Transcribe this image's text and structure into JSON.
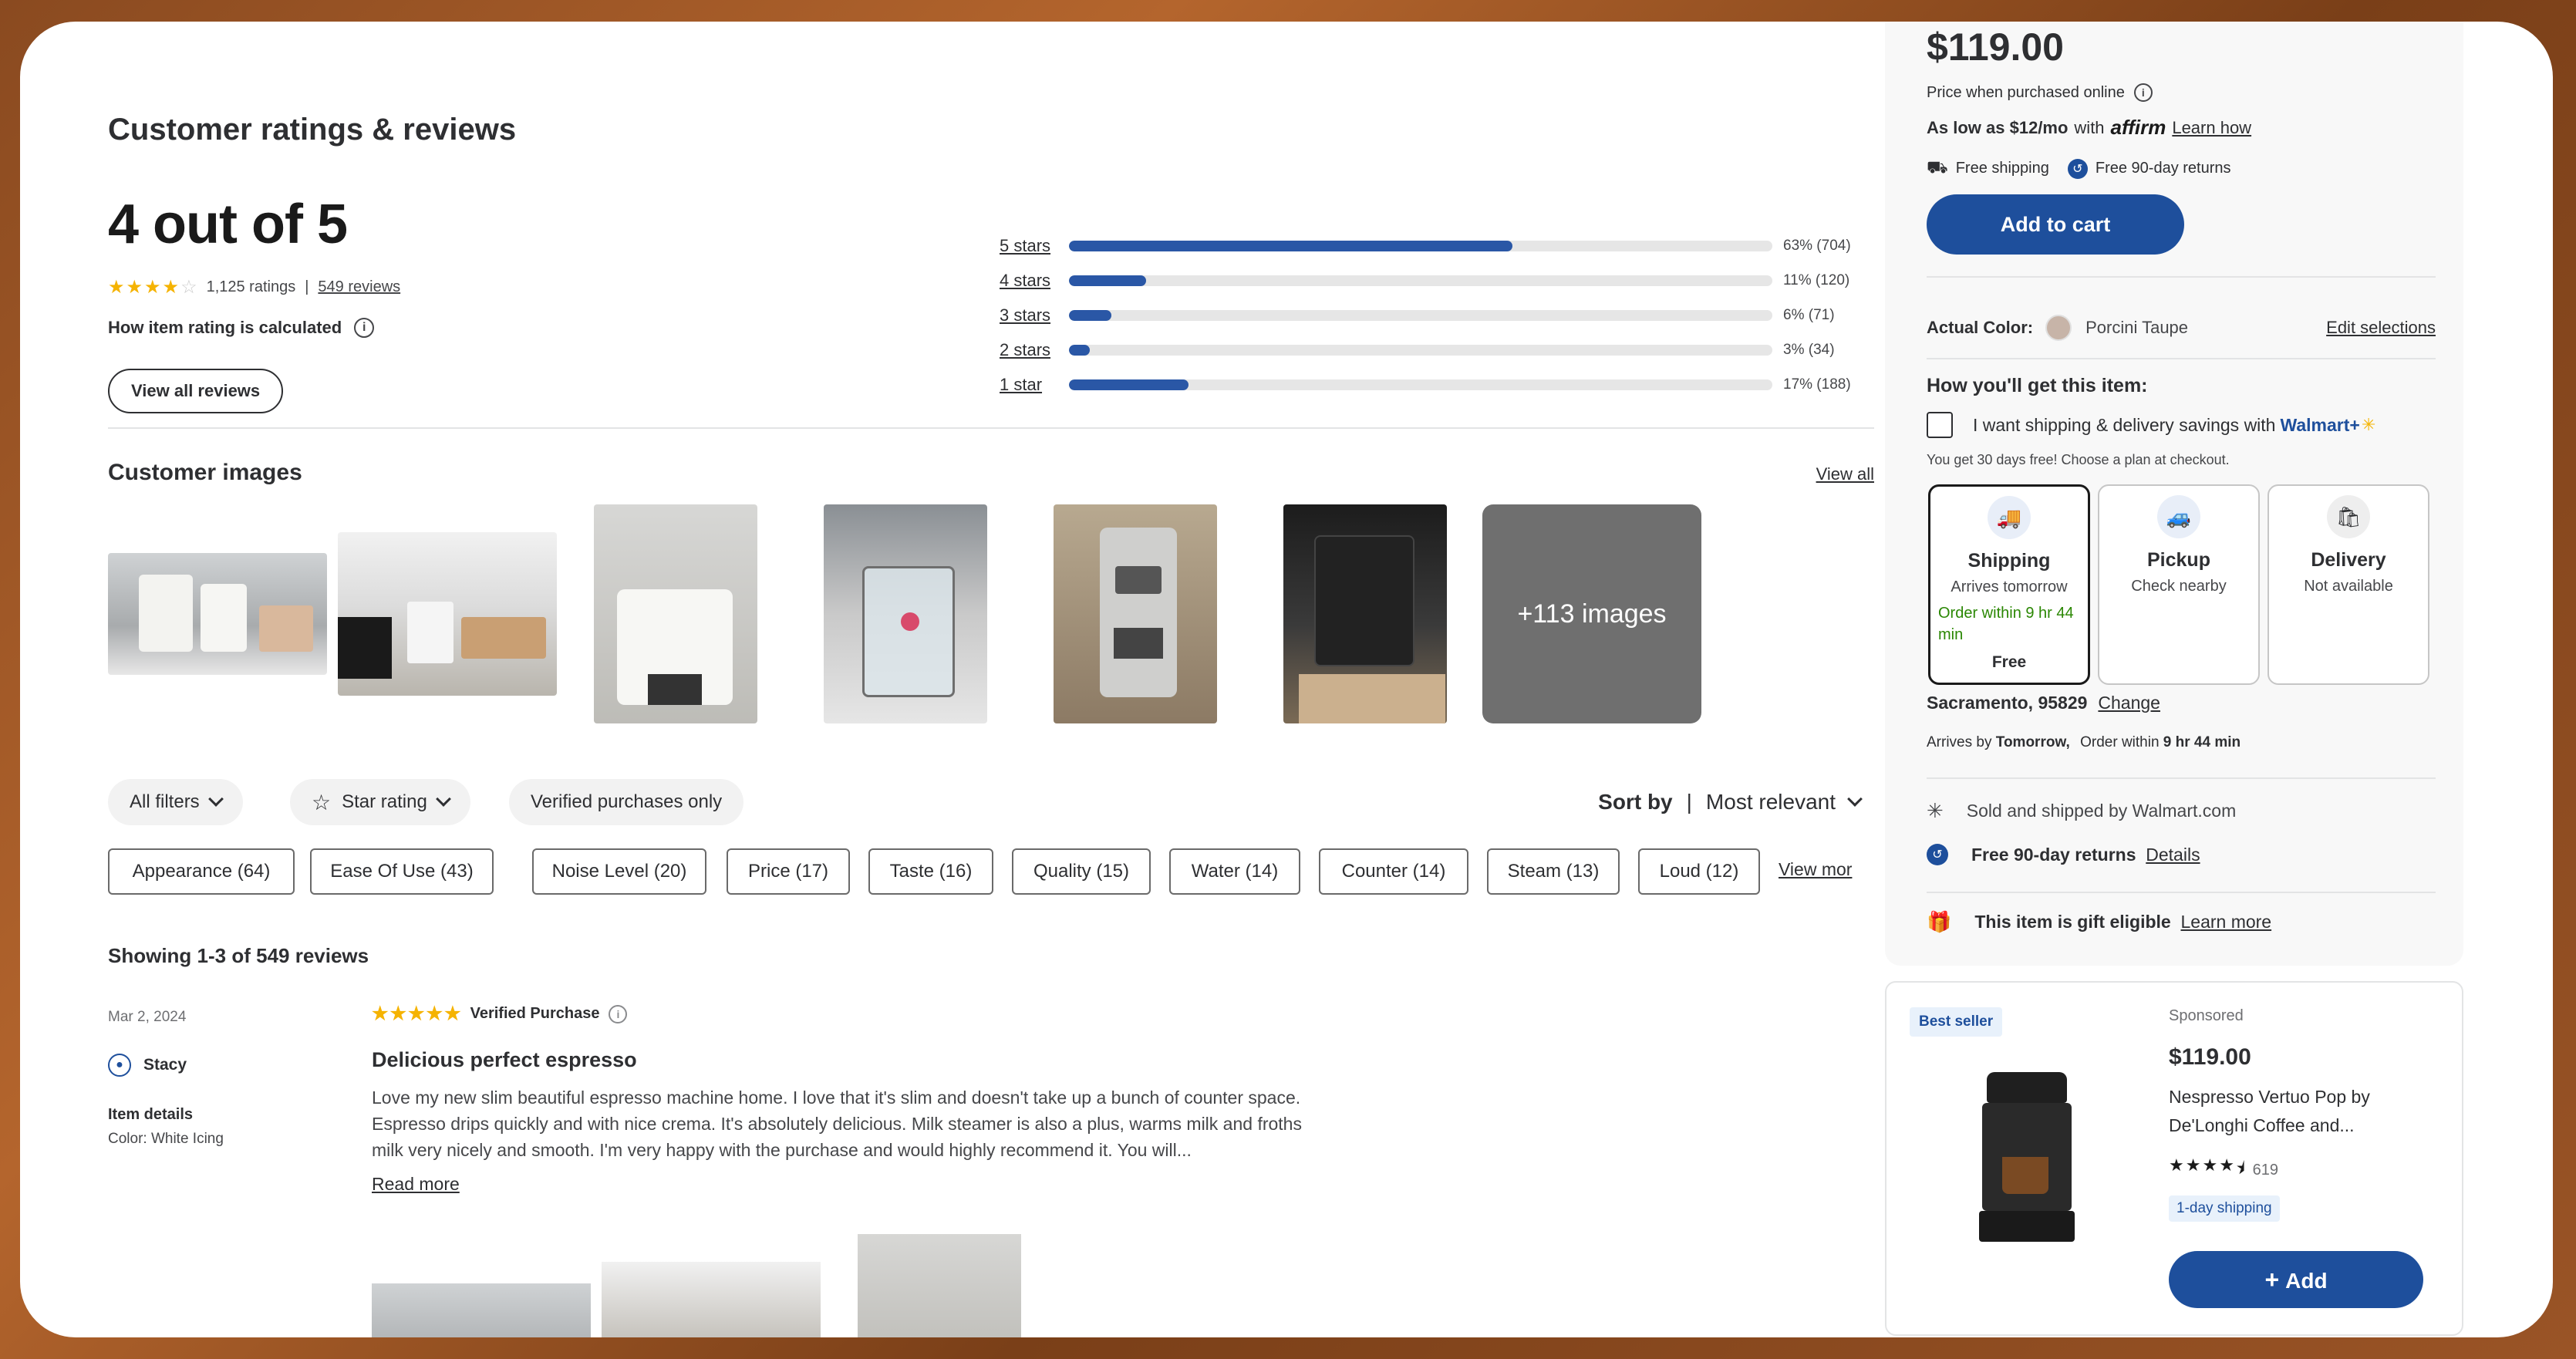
{
  "ratings": {
    "heading": "Customer ratings & reviews",
    "summary": "4 out of 5",
    "stars_value": 4,
    "ratings_count": "1,125 ratings",
    "separator": "|",
    "reviews_link": "549 reviews",
    "how_calc": "How item rating is calculated",
    "view_all_reviews": "View all reviews",
    "histogram": [
      {
        "label": "5 stars",
        "fraction": 0.63,
        "pct": "63% (704)"
      },
      {
        "label": "4 stars",
        "fraction": 0.11,
        "pct": "11% (120)"
      },
      {
        "label": "3 stars",
        "fraction": 0.06,
        "pct": "6% (71)"
      },
      {
        "label": "2 stars",
        "fraction": 0.03,
        "pct": "3% (34)"
      },
      {
        "label": "1 star",
        "fraction": 0.17,
        "pct": "17% (188)"
      }
    ]
  },
  "customer_images": {
    "heading": "Customer images",
    "view_all": "View all",
    "more_label": "+113 images"
  },
  "filters": {
    "all_filters": "All filters",
    "star_rating": "Star rating",
    "verified": "Verified purchases only",
    "sort_by": "Sort by",
    "sort_sep": "|",
    "sort_value": "Most relevant",
    "tags": [
      "Appearance (64)",
      "Ease Of Use (43)",
      "Noise Level (20)",
      "Price (17)",
      "Taste (16)",
      "Quality (15)",
      "Water (14)",
      "Counter (14)",
      "Steam (13)",
      "Loud (12)"
    ],
    "view_more": "View mor"
  },
  "reviews": {
    "showing": "Showing 1-3 of 549 reviews",
    "first": {
      "date": "Mar 2, 2024",
      "user": "Stacy",
      "details_label": "Item details",
      "details_value": "Color: White Icing",
      "verified": "Verified Purchase",
      "title": "Delicious perfect espresso",
      "text": "Love my new slim beautiful espresso machine home. I love that it's slim and doesn't take up a bunch of counter space. Espresso drips quickly and with nice crema. It's absolutely delicious. Milk steamer is also a plus, warms milk and froths milk very nicely and smooth. I'm very happy with the purchase and would highly recommend it. You will...",
      "read_more": "Read more"
    }
  },
  "buybox": {
    "price": "$119.00",
    "price_note": "Price when purchased online",
    "affirm_lead": "As low as $12/mo",
    "affirm_with": "with",
    "affirm_logo": "affirm",
    "affirm_link": "Learn how",
    "free_shipping": "Free shipping",
    "free_returns": "Free 90-day returns",
    "add_to_cart": "Add to cart",
    "actual_color_label": "Actual Color:",
    "actual_color_value": "Porcini Taupe",
    "edit_selections": "Edit selections",
    "how_get": "How you'll get this item:",
    "walmart_plus_text": "I want shipping & delivery savings with",
    "walmart_plus_brand": "Walmart+",
    "trial": "You get 30 days free! Choose a plan at checkout.",
    "options": [
      {
        "title": "Shipping",
        "sub": "Arrives tomorrow",
        "green": "Order within 9 hr 44 min",
        "foot": "Free"
      },
      {
        "title": "Pickup",
        "sub": "Check nearby"
      },
      {
        "title": "Delivery",
        "sub": "Not available"
      }
    ],
    "location": "Sacramento, 95829",
    "change": "Change",
    "arrives_prefix": "Arrives by",
    "arrives_day": "Tomorrow,",
    "order_within_prefix": "Order within",
    "order_within_time": "9 hr 44 min",
    "sold_by": "Sold and shipped by Walmart.com",
    "returns": "Free 90-day returns",
    "returns_link": "Details",
    "gift": "This item is gift eligible",
    "gift_link": "Learn more"
  },
  "sponsored": {
    "badge": "Best seller",
    "label": "Sponsored",
    "price": "$119.00",
    "name": "Nespresso Vertuo Pop by De'Longhi Coffee and...",
    "rating_value": 4.5,
    "count": "619",
    "shipping": "1-day shipping",
    "add": "Add"
  },
  "colors": {
    "accent": "#1e4f9c",
    "bar": "#2a57a6",
    "star": "#f5b301",
    "green": "#2a8703"
  }
}
